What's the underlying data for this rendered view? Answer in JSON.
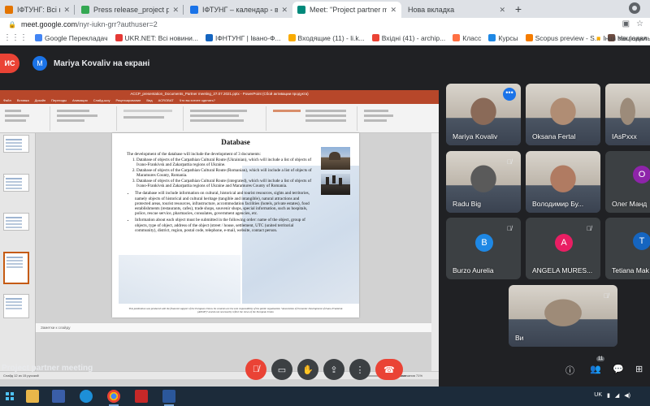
{
  "browser": {
    "tabs": [
      {
        "label": "ΙФТУНГ: Всі новини України, о",
        "fav": "#e37400"
      },
      {
        "label": "Press release_project partner m",
        "fav": "#34a853"
      },
      {
        "label": "ΙФТУНГ – календар - вівторок",
        "fav": "#1a73e8"
      },
      {
        "label": "Meet: \"Project partner meet",
        "fav": "#00897b"
      },
      {
        "label": "Нова вкладка",
        "fav": "#dee1e6"
      }
    ],
    "new_tab": "+",
    "url_host": "meet.google.com",
    "url_path": "/nyr-iukn-grr?authuser=2",
    "bookmarks": [
      {
        "label": "Google Перекладач",
        "fav": "#4285f4"
      },
      {
        "label": "UKR.NET: Всі новини...",
        "fav": "#e53935"
      },
      {
        "label": "ІФНТУНГ | Івано-Ф...",
        "fav": "#1565c0"
      },
      {
        "label": "Входящие (11) - li.k...",
        "fav": "#f9ab00"
      },
      {
        "label": "Вхідні (41) - archip...",
        "fav": "#ea4335"
      },
      {
        "label": "Класс",
        "fav": "#ff7043"
      },
      {
        "label": "Курсы",
        "fav": "#1e88e5"
      },
      {
        "label": "Scopus preview - S...",
        "fav": "#f57c00"
      },
      {
        "label": "Національне агент...",
        "fav": "#6d4c41"
      }
    ],
    "bookmarks_other": "Інші закладки"
  },
  "meet": {
    "stop_label": "ИС",
    "presenter_initial": "M",
    "presenter_text": "Mariya Kovaliv на екрані",
    "meeting_title": "Project partner meeting",
    "people_badge": "11",
    "participants": [
      {
        "name": "Mariya Kovaliv",
        "kind": "video",
        "tone": "#8a6a58"
      },
      {
        "name": "Oksana Fertal",
        "kind": "video",
        "tone": "#b08d74"
      },
      {
        "name": "IAsPxxx",
        "kind": "video",
        "tone": "#9c8b7a"
      },
      {
        "name": "Radu Big",
        "kind": "video",
        "tone": "#5a5a5a"
      },
      {
        "name": "Володимир Бу...",
        "kind": "video",
        "tone": "#b07b62"
      },
      {
        "name": "Олег Манд",
        "kind": "avatar",
        "initial": "О",
        "color": "#8e24aa"
      },
      {
        "name": "Burzo Aurelia",
        "kind": "avatar",
        "initial": "B",
        "color": "#1e88e5"
      },
      {
        "name": "ANGELA MURES...",
        "kind": "avatar",
        "initial": "A",
        "color": "#e91e63"
      },
      {
        "name": "Tetiana Mak",
        "kind": "avatar",
        "initial": "T",
        "color": "#1565c0"
      },
      {
        "name": "Ви",
        "kind": "video",
        "tone": "#9e8b78"
      }
    ]
  },
  "ppt": {
    "window_title": "ACCP_presentation_Documents_Partner meeting_27.07.2021.pptx - PowerPoint (Сбой активации продукта)",
    "menu_tabs": [
      "Файл",
      "Вставка",
      "Дизайн",
      "Переходы",
      "Анимация",
      "Слайд-шоу",
      "Рецензирование",
      "Вид",
      "ACROBAT",
      "Что вы хотите сделать?"
    ],
    "slide_numbers": [
      "9",
      "10",
      "11",
      "12",
      "13"
    ],
    "notes_placeholder": "Заметки к слайду",
    "status_left": "Слайд 12 из 15   русский",
    "status_right": "Заметки   Примечания       71%"
  },
  "slide": {
    "title": "Database",
    "intro": "The development of the database will include the development of 3 documents:",
    "numbered": [
      "Database of objects of the Carpathian Cultural Route (Ukrainian), which will include a list of objects of Ivano-Frankivsk and Zakarpattia regions of Ukraine.",
      "Database of objects of the Carpathian Cultural Route (Romanian), which will include a list of objects of Maramures County, Romania.",
      "Database of objects of the Carpathian Cultural Route (integrated), which will include a list of objects of Ivano-Frankivsk and Zakarpattia regions of Ukraine and Maramures County of Romania."
    ],
    "bullets": [
      "The database will include information on cultural, historical and tourist resources, sights and territories, namely objects of historical and cultural heritage (tangible and intangible), natural attractions and protected areas, tourist resources, infrastructure, accommodation facilities (hotels, private estates), food establishments (restaurants, cafes), trade shops, souvenir shops, special information, such as hospitals, police, rescue service, pharmacies, consulates, government agencies, etc.",
      "Information about each object must be submitted in the following order: name of the object, group of objects, type of object, address of the object (street / house, settlement, UTC (united territorial community), district, region, postal code, telephone, e-mail, website, contact person."
    ],
    "footer": "This publication was produced with the financial support of the European Union. Its contents are the sole responsibility of the public organization \"Association of Economic Development of Ivano-Frankivsk (AEDIF)\" and do not necessarily reflect the views of the European Union"
  },
  "taskbar": {
    "lang": "UK"
  }
}
